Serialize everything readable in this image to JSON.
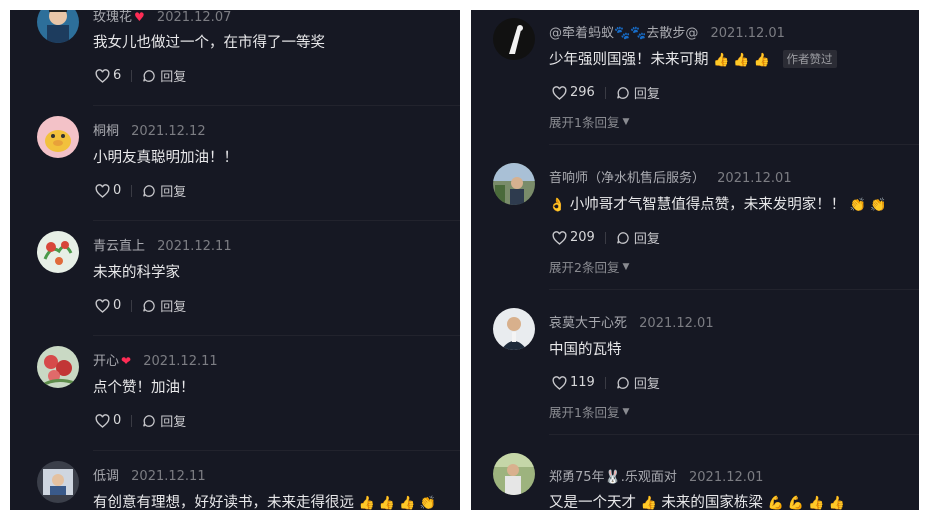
{
  "left_comments": [
    {
      "username": "玫瑰花",
      "date": "2021.12.07",
      "text": "我女儿也做过一个，在市得了一等奖",
      "likes": "6",
      "reply_label": "回复"
    },
    {
      "username": "桐桐",
      "date": "2021.12.12",
      "text": "小明友真聪明加油！！",
      "likes": "0",
      "reply_label": "回复"
    },
    {
      "username": "青云直上",
      "date": "2021.12.11",
      "text": "未来的科学家",
      "likes": "0",
      "reply_label": "回复"
    },
    {
      "username": "开心",
      "username_emoji": "❤",
      "date": "2021.12.11",
      "text": "点个赞！加油！",
      "likes": "0",
      "reply_label": "回复"
    },
    {
      "username": "低调",
      "date": "2021.12.11",
      "text": "有创意有理想，好好读书，未来走得很远",
      "trailing_emojis": "👍 👍 👍 👏"
    }
  ],
  "right_comments": [
    {
      "username": "@牵着蚂蚁🐾🐾去散步@",
      "date": "2021.12.01",
      "text": "少年强则国强！未来可期",
      "trailing_emojis": "👍 👍 👍",
      "badge": "作者赞过",
      "likes": "296",
      "reply_label": "回复",
      "expand": "展开1条回复"
    },
    {
      "username": "音响师（净水机售后服务）",
      "date": "2021.12.01",
      "leading_emoji": "👌",
      "text": "小帅哥才气智慧值得点赞，未来发明家！！",
      "trailing_emojis": "👏 👏",
      "likes": "209",
      "reply_label": "回复",
      "expand": "展开2条回复"
    },
    {
      "username": "哀莫大于心死",
      "date": "2021.12.01",
      "text": "中国的瓦特",
      "likes": "119",
      "reply_label": "回复",
      "expand": "展开1条回复"
    },
    {
      "username": "郑勇75年🐰.乐观面对",
      "date": "2021.12.01",
      "text": "又是一个天才",
      "mid_text": "未来的国家栋梁",
      "emoji_a": "👍",
      "trailing_emojis": "💪 💪 👍 👍"
    }
  ],
  "colors": {
    "background": "#161823",
    "like_heart": "#fe2c55",
    "text_primary": "#e8e8ea",
    "text_secondary": "#8a8b91"
  }
}
